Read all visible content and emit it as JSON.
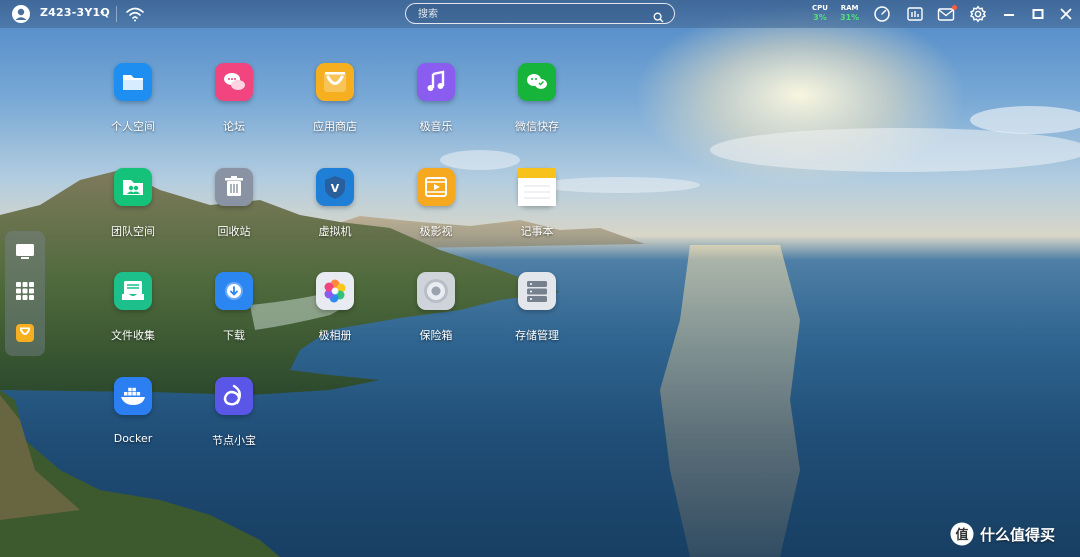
{
  "topbar": {
    "device_name": "Z423-3Y1Q",
    "search_placeholder": "搜索",
    "cpu": {
      "label": "CPU",
      "value": "3%"
    },
    "ram": {
      "label": "RAM",
      "value": "31%"
    }
  },
  "apps": [
    {
      "label": "个人空间",
      "icon": "folder-icon",
      "color": "#1e8ff0"
    },
    {
      "label": "论坛",
      "icon": "chat-bubbles-icon",
      "color": "#f2447e"
    },
    {
      "label": "应用商店",
      "icon": "store-bag-icon",
      "color": "#f6b01f"
    },
    {
      "label": "极音乐",
      "icon": "music-note-icon",
      "color": "#8a5cf0"
    },
    {
      "label": "微信快存",
      "icon": "wechat-icon",
      "color": "#16b43a"
    },
    {
      "label": "团队空间",
      "icon": "team-folder-icon",
      "color": "#15c27a"
    },
    {
      "label": "回收站",
      "icon": "trash-icon",
      "color": "#8a93a3"
    },
    {
      "label": "虚拟机",
      "icon": "shield-v-icon",
      "color": "#1f7fd6"
    },
    {
      "label": "极影视",
      "icon": "film-icon",
      "color": "#f6a81e"
    },
    {
      "label": "记事本",
      "icon": "notepad-icon",
      "color": "#f7c21a"
    },
    {
      "label": "文件收集",
      "icon": "inbox-icon",
      "color": "#1dbf8a"
    },
    {
      "label": "下载",
      "icon": "download-icon",
      "color": "#2b86f2"
    },
    {
      "label": "极相册",
      "icon": "photo-flower-icon",
      "color": "#e8ecf2"
    },
    {
      "label": "保险箱",
      "icon": "safe-dial-icon",
      "color": "#cfd4db"
    },
    {
      "label": "存储管理",
      "icon": "server-icon",
      "color": "#e3e7ec"
    },
    {
      "label": "Docker",
      "icon": "docker-whale-icon",
      "color": "#2b7ff3"
    },
    {
      "label": "节点小宝",
      "icon": "node-knot-icon",
      "color": "#5a56e8"
    }
  ],
  "watermark": {
    "text": "什么值得买",
    "logo_char": "值"
  }
}
